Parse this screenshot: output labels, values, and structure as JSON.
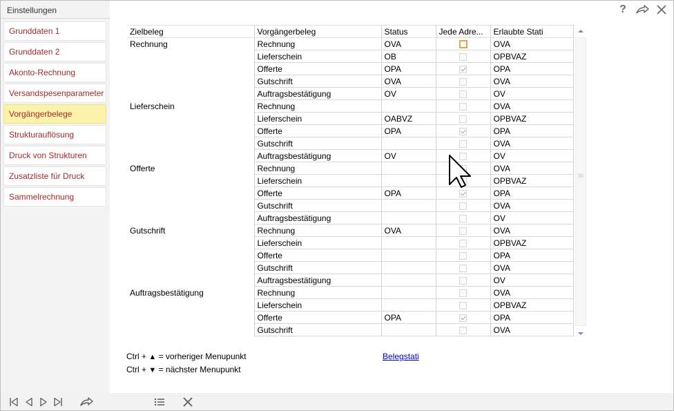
{
  "window": {
    "title": "Einstellungen"
  },
  "sidebar": {
    "items": [
      {
        "label": "Grunddaten 1",
        "active": false
      },
      {
        "label": "Grunddaten 2",
        "active": false
      },
      {
        "label": "Akonto-Rechnung",
        "active": false
      },
      {
        "label": "Versandspesenparameter",
        "active": false
      },
      {
        "label": "Vorgängerbelege",
        "active": true
      },
      {
        "label": "Strukturauflösung",
        "active": false
      },
      {
        "label": "Druck von Strukturen",
        "active": false
      },
      {
        "label": "Zusatzliste für Druck",
        "active": false
      },
      {
        "label": "Sammelrechnung",
        "active": false
      }
    ]
  },
  "top_icons": [
    "help-icon",
    "forward-icon",
    "close-icon"
  ],
  "table": {
    "columns": [
      "Zielbeleg",
      "Vorgängerbeleg",
      "Status",
      "Jede Adre...",
      "Erlaubte Stati"
    ],
    "rows": [
      {
        "ziel": "Rechnung",
        "vorg": "Rechnung",
        "status": "OVA",
        "checked": false,
        "focus": true,
        "erlaubt": "OVA"
      },
      {
        "ziel": "",
        "vorg": "Lieferschein",
        "status": "OB",
        "checked": false,
        "focus": false,
        "erlaubt": "OPBVAZ"
      },
      {
        "ziel": "",
        "vorg": "Offerte",
        "status": "OPA",
        "checked": true,
        "focus": false,
        "erlaubt": "OPA"
      },
      {
        "ziel": "",
        "vorg": "Gutschrift",
        "status": "OVA",
        "checked": false,
        "focus": false,
        "erlaubt": "OVA"
      },
      {
        "ziel": "",
        "vorg": "Auftragsbestätigung",
        "status": "OV",
        "checked": false,
        "focus": false,
        "erlaubt": "OV"
      },
      {
        "ziel": "Lieferschein",
        "vorg": "Rechnung",
        "status": "",
        "checked": false,
        "focus": false,
        "erlaubt": "OVA"
      },
      {
        "ziel": "",
        "vorg": "Lieferschein",
        "status": "OABVZ",
        "checked": false,
        "focus": false,
        "erlaubt": "OPBVAZ"
      },
      {
        "ziel": "",
        "vorg": "Offerte",
        "status": "OPA",
        "checked": true,
        "focus": false,
        "erlaubt": "OPA"
      },
      {
        "ziel": "",
        "vorg": "Gutschrift",
        "status": "",
        "checked": false,
        "focus": false,
        "erlaubt": "OVA"
      },
      {
        "ziel": "",
        "vorg": "Auftragsbestätigung",
        "status": "OV",
        "checked": false,
        "focus": false,
        "erlaubt": "OV"
      },
      {
        "ziel": "Offerte",
        "vorg": "Rechnung",
        "status": "",
        "checked": false,
        "focus": false,
        "erlaubt": "OVA"
      },
      {
        "ziel": "",
        "vorg": "Lieferschein",
        "status": "",
        "checked": false,
        "focus": false,
        "erlaubt": "OPBVAZ"
      },
      {
        "ziel": "",
        "vorg": "Offerte",
        "status": "OPA",
        "checked": true,
        "focus": false,
        "erlaubt": "OPA"
      },
      {
        "ziel": "",
        "vorg": "Gutschrift",
        "status": "",
        "checked": false,
        "focus": false,
        "erlaubt": "OVA"
      },
      {
        "ziel": "",
        "vorg": "Auftragsbestätigung",
        "status": "",
        "checked": false,
        "focus": false,
        "erlaubt": "OV"
      },
      {
        "ziel": "Gutschrift",
        "vorg": "Rechnung",
        "status": "OVA",
        "checked": false,
        "focus": false,
        "erlaubt": "OVA"
      },
      {
        "ziel": "",
        "vorg": "Lieferschein",
        "status": "",
        "checked": false,
        "focus": false,
        "erlaubt": "OPBVAZ"
      },
      {
        "ziel": "",
        "vorg": "Offerte",
        "status": "",
        "checked": false,
        "focus": false,
        "erlaubt": "OPA"
      },
      {
        "ziel": "",
        "vorg": "Gutschrift",
        "status": "",
        "checked": false,
        "focus": false,
        "erlaubt": "OVA"
      },
      {
        "ziel": "",
        "vorg": "Auftragsbestätigung",
        "status": "",
        "checked": false,
        "focus": false,
        "erlaubt": "OV"
      },
      {
        "ziel": "Auftragsbestätigung",
        "vorg": "Rechnung",
        "status": "",
        "checked": false,
        "focus": false,
        "erlaubt": "OVA"
      },
      {
        "ziel": "",
        "vorg": "Lieferschein",
        "status": "",
        "checked": false,
        "focus": false,
        "erlaubt": "OPBVAZ"
      },
      {
        "ziel": "",
        "vorg": "Offerte",
        "status": "OPA",
        "checked": true,
        "focus": false,
        "erlaubt": "OPA"
      },
      {
        "ziel": "",
        "vorg": "Gutschrift",
        "status": "",
        "checked": false,
        "focus": false,
        "erlaubt": "OVA"
      }
    ]
  },
  "hints": {
    "prev_prefix": "Ctrl + ",
    "prev_arrow": "▲",
    "prev_text": " = vorheriger Menupunkt",
    "next_prefix": "Ctrl + ",
    "next_arrow": "▼",
    "next_text": " = nächster Menupunkt"
  },
  "link": {
    "label": "Belegstati"
  },
  "bottom_icons": [
    "first-record-icon",
    "previous-record-icon",
    "next-record-icon",
    "last-record-icon",
    "share-icon",
    "list-icon",
    "cancel-icon"
  ],
  "colors": {
    "menu_text": "#a52a2a",
    "active_bg": "#fbf3a9",
    "link": "#0000cc",
    "focus_border": "#f0a040"
  }
}
